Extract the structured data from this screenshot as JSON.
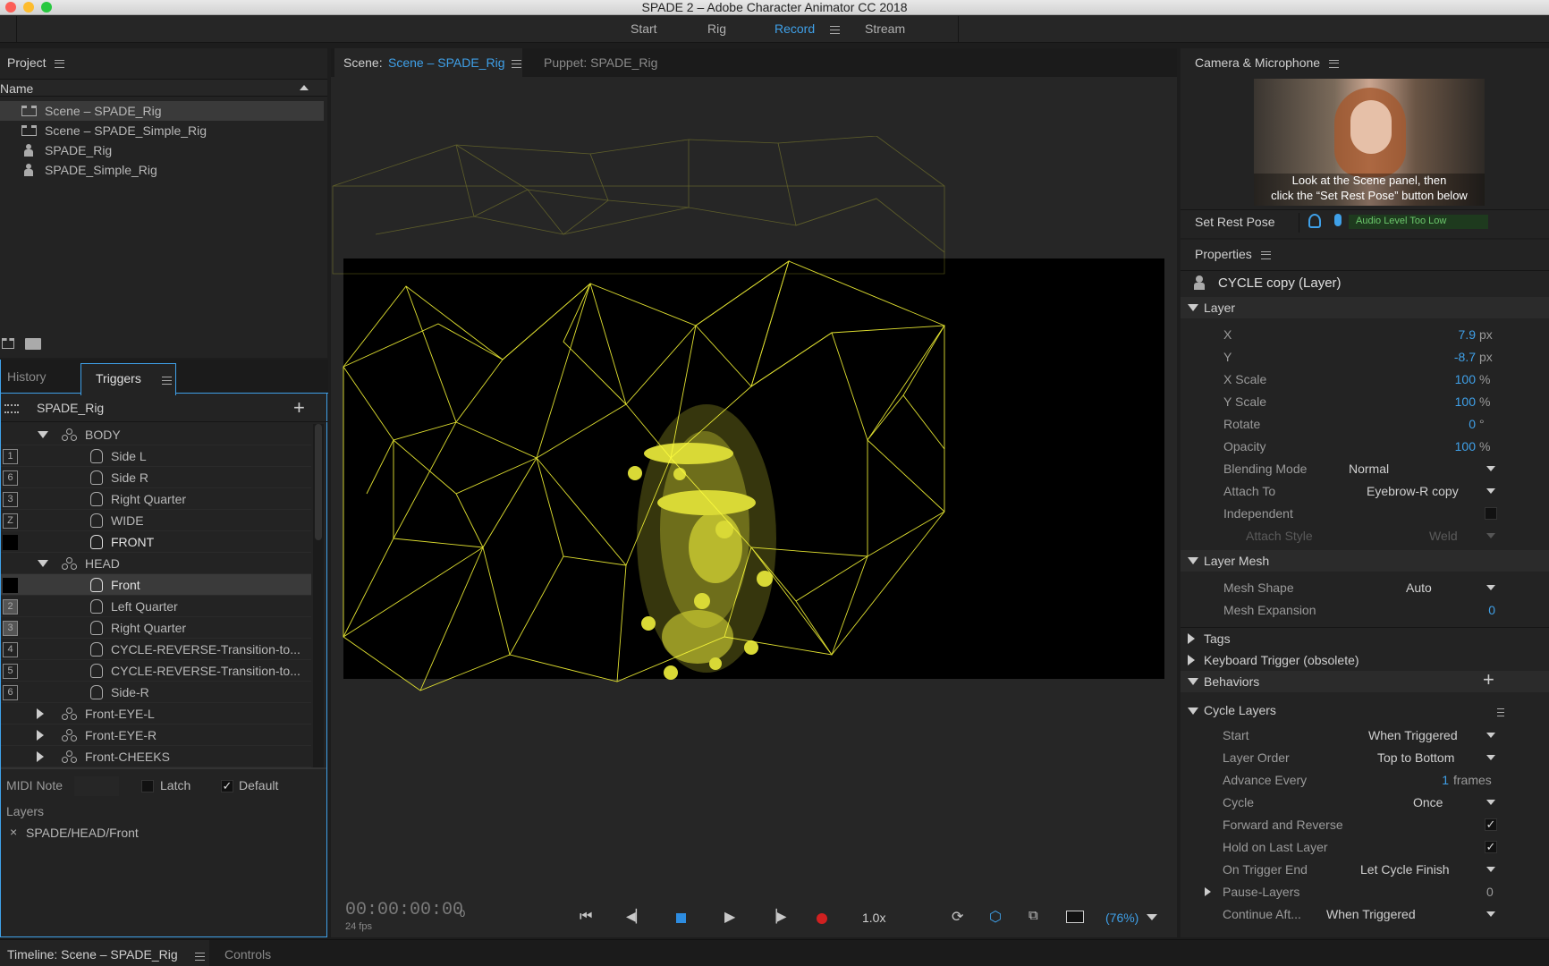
{
  "window": {
    "title": "SPADE 2 – Adobe Character Animator CC 2018"
  },
  "workspaces": [
    {
      "label": "Start"
    },
    {
      "label": "Rig"
    },
    {
      "label": "Record"
    },
    {
      "label": "Stream"
    }
  ],
  "project": {
    "title": "Project",
    "column": "Name",
    "items": [
      {
        "label": "Scene – SPADE_Rig",
        "kind": "scene"
      },
      {
        "label": "Scene – SPADE_Simple_Rig",
        "kind": "scene"
      },
      {
        "label": "SPADE_Rig",
        "kind": "puppet"
      },
      {
        "label": "SPADE_Simple_Rig",
        "kind": "puppet"
      }
    ]
  },
  "triggers": {
    "tab_history": "History",
    "tab_triggers": "Triggers",
    "puppet": "SPADE_Rig",
    "rows": [
      {
        "key": "",
        "label": "BODY"
      },
      {
        "key": "1",
        "label": "Side L"
      },
      {
        "key": "6",
        "label": "Side R"
      },
      {
        "key": "3",
        "label": "Right Quarter"
      },
      {
        "key": "Z",
        "label": "WIDE"
      },
      {
        "key": "",
        "label": "FRONT"
      },
      {
        "key": "",
        "label": "HEAD"
      },
      {
        "key": "",
        "label": "Front"
      },
      {
        "key": "2",
        "label": "Left Quarter"
      },
      {
        "key": "3",
        "label": "Right Quarter"
      },
      {
        "key": "4",
        "label": "CYCLE-REVERSE-Transition-to..."
      },
      {
        "key": "5",
        "label": "CYCLE-REVERSE-Transition-to..."
      },
      {
        "key": "6",
        "label": "Side-R"
      },
      {
        "key": "",
        "label": "Front-EYE-L"
      },
      {
        "key": "",
        "label": "Front-EYE-R"
      },
      {
        "key": "",
        "label": "Front-CHEEKS"
      }
    ],
    "midi_note": "MIDI Note",
    "latch": "Latch",
    "default": "Default",
    "layers_label": "Layers",
    "layer_path": "SPADE/HEAD/Front"
  },
  "scene": {
    "tab_prefix": "Scene:",
    "tab_name": "Scene – SPADE_Rig",
    "puppet_tab": "Puppet: SPADE_Rig",
    "timecode": "00:00:00:00",
    "frame": "0",
    "fps": "24 fps",
    "speed": "1.0x",
    "zoom": "(76%)"
  },
  "camera": {
    "title": "Camera & Microphone",
    "hint_line1": "Look at the Scene panel, then",
    "hint_line2": "click the “Set Rest Pose” button below",
    "rest_pose": "Set Rest Pose",
    "audio_status": "Audio Level Too Low"
  },
  "properties": {
    "title": "Properties",
    "layer_name": "CYCLE copy (Layer)",
    "layer_section": "Layer",
    "x_label": "X",
    "x_value": "7.9",
    "x_unit": "px",
    "y_label": "Y",
    "y_value": "-8.7",
    "y_unit": "px",
    "xscale_label": "X Scale",
    "xscale_value": "100",
    "xscale_unit": "%",
    "yscale_label": "Y Scale",
    "yscale_value": "100",
    "yscale_unit": "%",
    "rotate_label": "Rotate",
    "rotate_value": "0",
    "rotate_unit": "°",
    "opacity_label": "Opacity",
    "opacity_value": "100",
    "opacity_unit": "%",
    "blend_label": "Blending Mode",
    "blend_value": "Normal",
    "attach_label": "Attach To",
    "attach_value": "Eyebrow-R copy",
    "independent_label": "Independent",
    "attach_style_label": "Attach Style",
    "attach_style_value": "Weld",
    "mesh_section": "Layer Mesh",
    "mesh_shape_label": "Mesh Shape",
    "mesh_shape_value": "Auto",
    "mesh_exp_label": "Mesh Expansion",
    "mesh_exp_value": "0",
    "tags": "Tags",
    "keyboard_trigger": "Keyboard Trigger (obsolete)",
    "behaviors": "Behaviors",
    "cycle_layers": "Cycle Layers",
    "start_label": "Start",
    "start_value": "When Triggered",
    "order_label": "Layer Order",
    "order_value": "Top to Bottom",
    "advance_label": "Advance Every",
    "advance_value": "1",
    "advance_unit": "frames",
    "cycle_label": "Cycle",
    "cycle_value": "Once",
    "fwd_label": "Forward and Reverse",
    "hold_label": "Hold on Last Layer",
    "end_label": "On Trigger End",
    "end_value": "Let Cycle Finish",
    "pause_label": "Pause-Layers",
    "pause_value": "0",
    "continue_label": "Continue Aft...",
    "continue_value": "When Triggered"
  },
  "bottom": {
    "timeline": "Timeline: Scene – SPADE_Rig",
    "controls": "Controls"
  }
}
